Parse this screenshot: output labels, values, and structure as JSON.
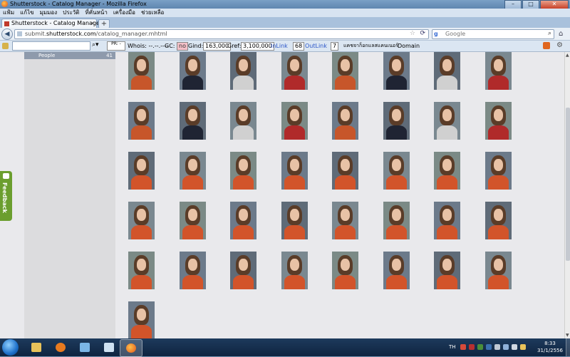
{
  "window": {
    "title": "Shutterstock - Catalog Manager - Mozilla Firefox"
  },
  "menu": [
    "แฟ้ม",
    "แก้ไข",
    "มุมมอง",
    "ประวัติ",
    "ที่คั่นหน้า",
    "เครื่องมือ",
    "ช่วยเหลือ"
  ],
  "tab": {
    "label": "Shutterstock - Catalog Manager",
    "new_tab": "+"
  },
  "address": {
    "prefix": "submit.",
    "domain": "shutterstock.com",
    "path": "/catalog_manager.mhtml"
  },
  "search": {
    "engine": "g",
    "placeholder": "Google"
  },
  "seo_toolbar": {
    "pr_label": "PR: -",
    "whois": "Whois: --.--.----",
    "gc_label": "GC:",
    "gc_value": "no",
    "gind_label": "Gind:",
    "gind_value": "163,000",
    "gref_label": "Gref:",
    "gref_value": "3,100,000",
    "inlink_label": "InLink",
    "inlink_value": "68",
    "outlink_label": "OutLink",
    "outlink_value": "7",
    "thai_label": "แคชจาก็อกแลสแคนเนอร์",
    "domain_label": "Domain"
  },
  "sidebar": {
    "category": "People",
    "count": "41"
  },
  "feedback": {
    "label": "Feedback"
  },
  "taskbar": {
    "language": "TH",
    "time": "8:33",
    "date": "31/1/2556"
  },
  "colors": {
    "accent_feedback": "#6b9e2e",
    "sidebar_selected": "#8e9aac",
    "taskbar": "#173353"
  },
  "gallery": {
    "count": 41,
    "icons": [
      "photo-thumbnail"
    ]
  }
}
